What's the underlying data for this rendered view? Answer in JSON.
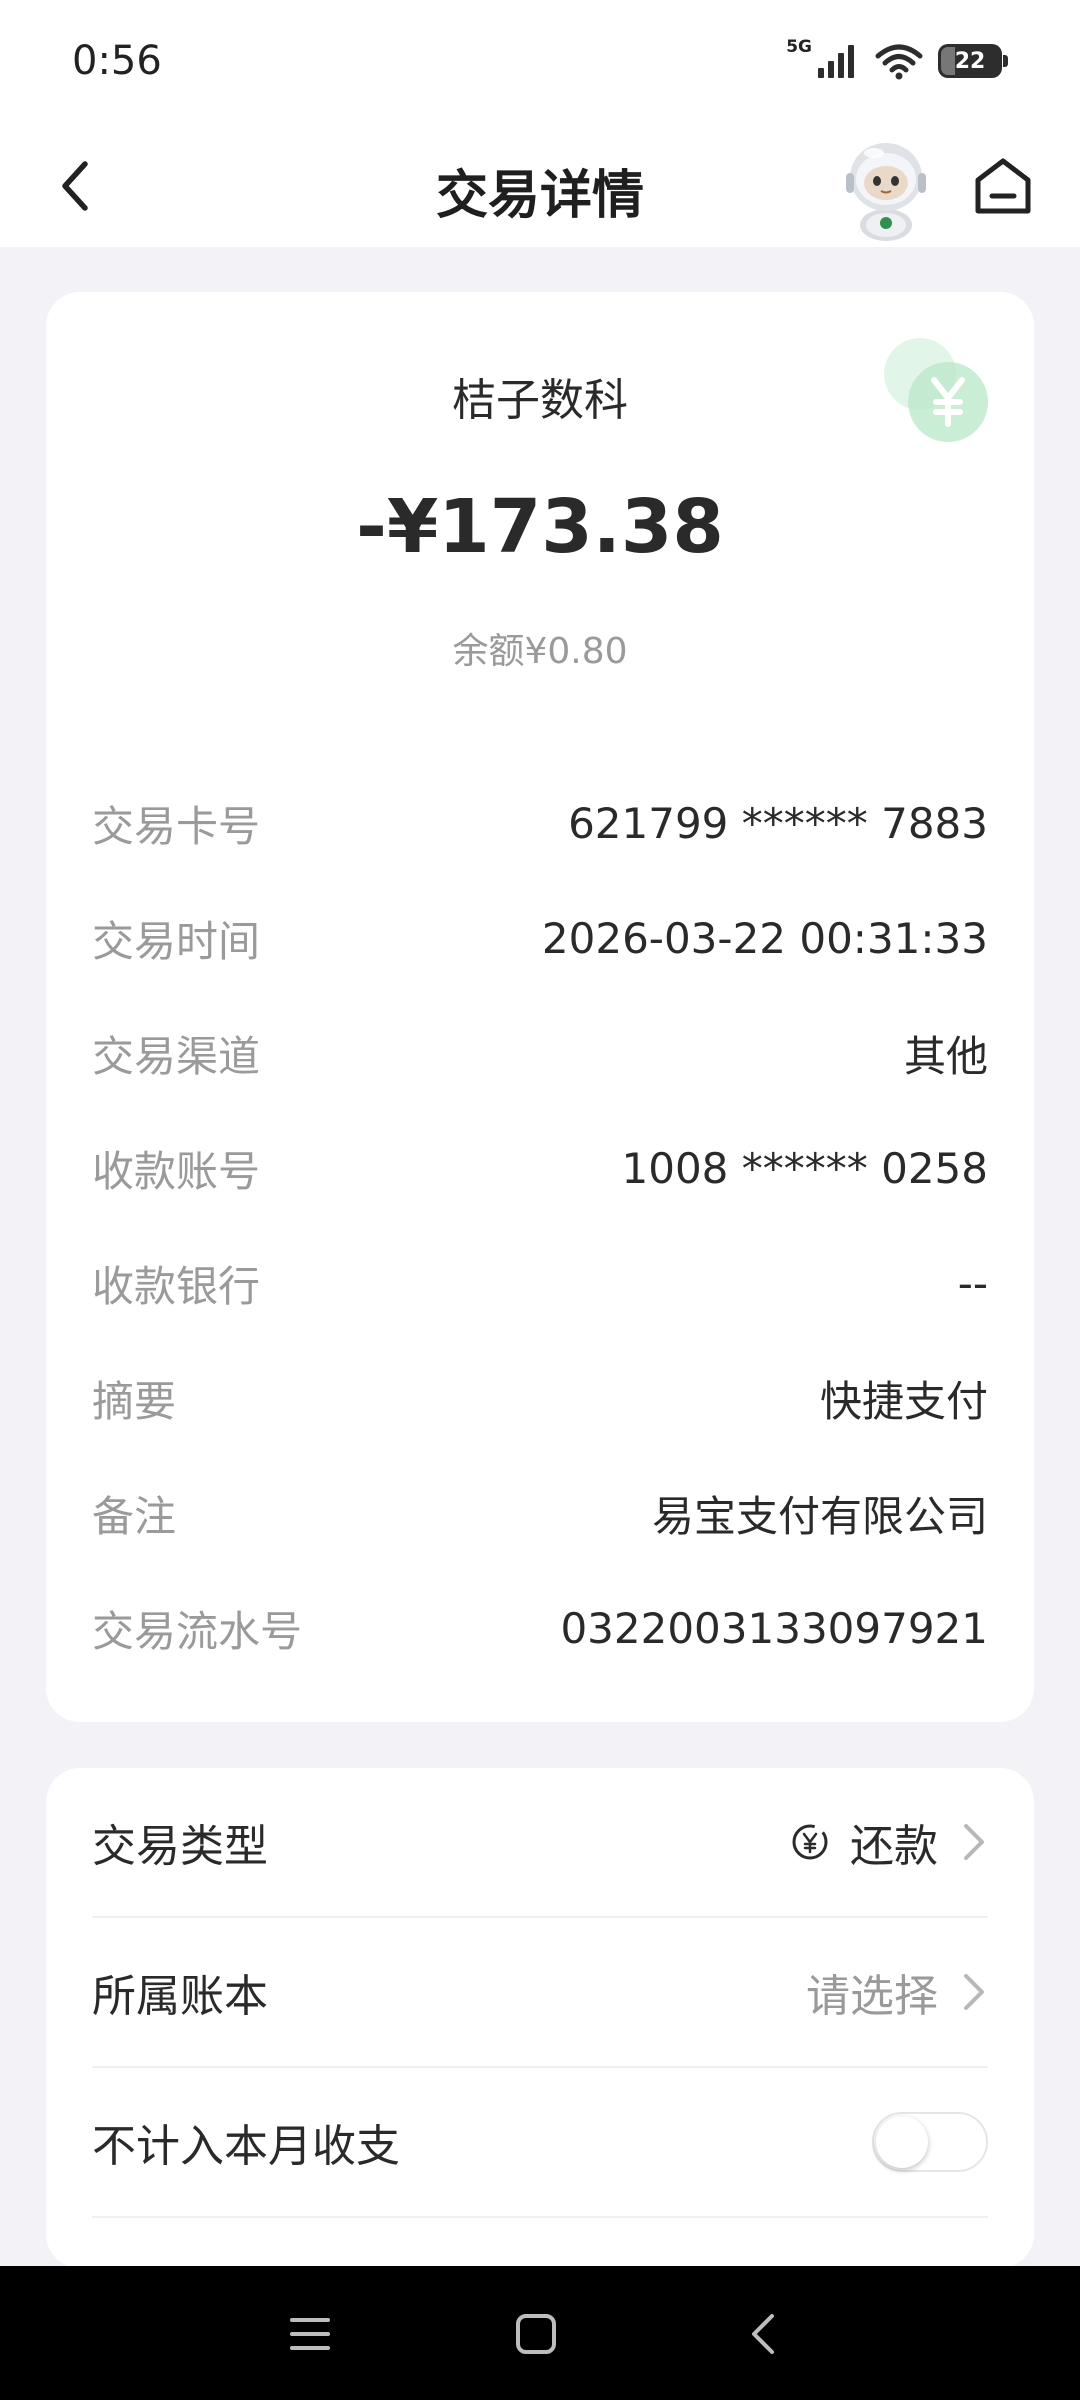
{
  "status_bar": {
    "time": "0:56",
    "network": "5G",
    "battery": "22"
  },
  "header": {
    "title": "交易详情",
    "back_icon": "chevron-left-icon",
    "assistant_icon": "robot-assistant-icon",
    "home_icon": "home-icon"
  },
  "transaction": {
    "merchant": "桔子数科",
    "amount": "-¥173.38",
    "balance": "余额¥0.80",
    "badge_icon": "yuan-coin-icon",
    "details": [
      {
        "label": "交易卡号",
        "value": "621799 ****** 7883"
      },
      {
        "label": "交易时间",
        "value": "2026-03-22 00:31:33"
      },
      {
        "label": "交易渠道",
        "value": "其他"
      },
      {
        "label": "收款账号",
        "value": "1008 ****** 0258"
      },
      {
        "label": "收款银行",
        "value": "--"
      },
      {
        "label": "摘要",
        "value": "快捷支付"
      },
      {
        "label": "备注",
        "value": "易宝支付有限公司"
      },
      {
        "label": "交易流水号",
        "value": "0322003133097921"
      }
    ]
  },
  "settings": {
    "type_label": "交易类型",
    "type_value": "还款",
    "type_icon": "repayment-yuan-icon",
    "ledger_label": "所属账本",
    "ledger_placeholder": "请选择",
    "exclude_label": "不计入本月收支",
    "exclude_enabled": false
  },
  "system_nav": {
    "menu_icon": "menu-icon",
    "home_icon": "square-home-icon",
    "back_icon": "back-arrow-icon"
  },
  "colors": {
    "background": "#f3f3f7",
    "card": "#ffffff",
    "accent_green": "#dff7e8",
    "label_gray": "#9a9a9a",
    "text_dark": "#2a2a2a"
  }
}
